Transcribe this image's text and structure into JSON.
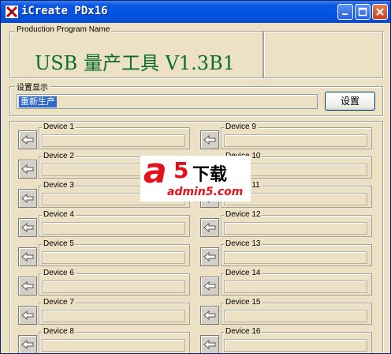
{
  "window": {
    "title": "iCreate PDx16",
    "icon": "tools-icon",
    "controls": [
      "minimize-icon",
      "maximize-icon",
      "close-icon"
    ]
  },
  "program_group": {
    "label": "Production Program Name",
    "name": "USB 量产工具 V1.3B1"
  },
  "settings_group": {
    "label": "设置显示",
    "value": "重新生产",
    "button_label": "设置"
  },
  "devices": [
    {
      "label": "Device 1"
    },
    {
      "label": "Device 2"
    },
    {
      "label": "Device 3"
    },
    {
      "label": "Device 4"
    },
    {
      "label": "Device 5"
    },
    {
      "label": "Device 6"
    },
    {
      "label": "Device 7"
    },
    {
      "label": "Device 8"
    },
    {
      "label": "Device 9"
    },
    {
      "label": "Device 10"
    },
    {
      "label": "Device 11"
    },
    {
      "label": "Device 12"
    },
    {
      "label": "Device 13"
    },
    {
      "label": "Device 14"
    },
    {
      "label": "Device 15"
    },
    {
      "label": "Device 16"
    }
  ],
  "watermark": {
    "logo": "a5",
    "text": "下载",
    "url": "admin5.com"
  },
  "colors": {
    "titlebar": "#0054E3",
    "window_bg": "#ECE0C5",
    "program_name": "#0A6E2A",
    "selection": "#316AC5",
    "watermark_red": "#E3111B"
  }
}
